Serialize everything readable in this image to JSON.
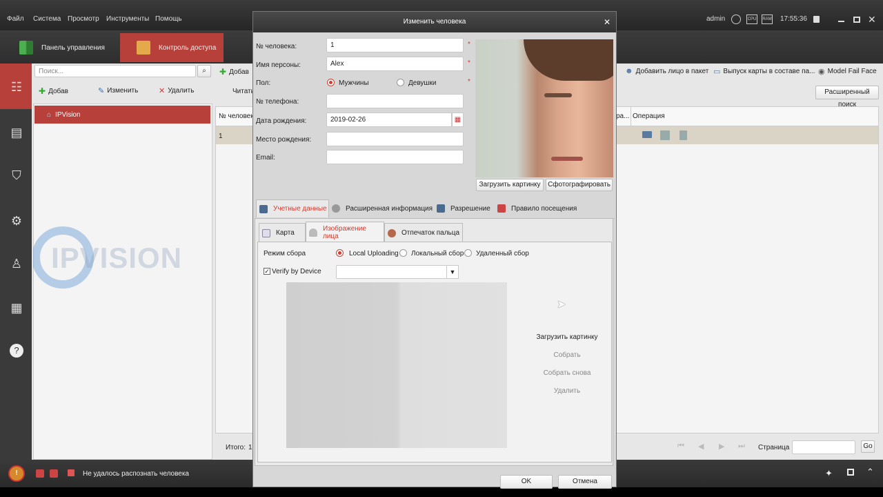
{
  "menubar": {
    "items": [
      "Файл",
      "Система",
      "Просмотр",
      "Инструменты",
      "Помощь"
    ],
    "user": "admin",
    "time": "17:55:36",
    "cpu_label": "CPU",
    "ram_label": "RAM"
  },
  "tabs": {
    "control_panel": "Панель управления",
    "access_control": "Контроль доступа"
  },
  "left": {
    "search_placeholder": "Поиск...",
    "add": "Добав",
    "edit": "Изменить",
    "delete": "Удалить",
    "org_name": "IPVision",
    "watermark": "IPVISION"
  },
  "main": {
    "add": "Добав",
    "read": "Читать",
    "add_face": "Добавить лицо в пакет",
    "card_issue": "Выпуск карты в составе па...",
    "model_fail": "Model Fail Face",
    "adv_search": "Расширенный поиск",
    "col_person": "№ человека",
    "col_op_prefix": "ра...",
    "col_operation": "Операция",
    "row_num": "1",
    "total_label": "Итого:",
    "total_val": "1",
    "page_label": "Страница",
    "go": "Go"
  },
  "dialog": {
    "title": "Изменить человека",
    "person_no_label": "№ человека:",
    "person_no": "1",
    "name_label": "Имя персоны:",
    "name": "Alex",
    "gender_label": "Пол:",
    "male": "Мужчины",
    "female": "Девушки",
    "phone_label": "№ телефона:",
    "birth_label": "Дата рождения:",
    "birth": "2019-02-26",
    "birthplace_label": "Место рождения:",
    "email_label": "Email:",
    "upload_photo": "Загрузить картинку",
    "take_photo": "Сфотографировать",
    "tab_credentials": "Учетные данные",
    "tab_extended": "Расширенная информация",
    "tab_permission": "Разрешение",
    "tab_visit": "Правило посещения",
    "subtab_card": "Карта",
    "subtab_face": "Изображение лица",
    "subtab_finger": "Отпечаток пальца",
    "capture_mode_label": "Режим сбора",
    "mode_local_upload": "Local Uploading",
    "mode_local": "Локальный сбор",
    "mode_remote": "Удаленный сбор",
    "verify_label": "Verify by Device",
    "action_upload": "Загрузить картинку",
    "action_collect": "Собрать",
    "action_recollect": "Собрать снова",
    "action_delete": "Удалить",
    "ok": "OK",
    "cancel": "Отмена"
  },
  "status": {
    "message": "Не удалось распознать человека"
  },
  "colors": {
    "accent": "#d23b2e",
    "tab_active": "#b8403a",
    "dialog_bg": "#d7d7d7"
  }
}
